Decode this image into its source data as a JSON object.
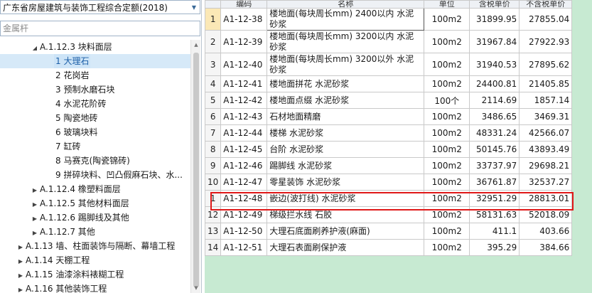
{
  "quota_selector": {
    "value": "广东省房屋建筑与装饰工程综合定额(2018)"
  },
  "search": {
    "placeholder": "金属杆",
    "value": ""
  },
  "tree": [
    {
      "label": "A.1.12.3 块料面层",
      "toggle": "◢",
      "level": 4
    },
    {
      "label": "1 大理石",
      "toggle": "",
      "level": 5,
      "selected": true
    },
    {
      "label": "2 花岗岩",
      "toggle": "",
      "level": 5
    },
    {
      "label": "3 预制水磨石块",
      "toggle": "",
      "level": 5
    },
    {
      "label": "4 水泥花阶砖",
      "toggle": "",
      "level": 5
    },
    {
      "label": "5 陶瓷地砖",
      "toggle": "",
      "level": 5
    },
    {
      "label": "6 玻璃块料",
      "toggle": "",
      "level": 5
    },
    {
      "label": "7 缸砖",
      "toggle": "",
      "level": 5
    },
    {
      "label": "8 马赛克(陶瓷锦砖)",
      "toggle": "",
      "level": 5
    },
    {
      "label": "9 拼碎块料、凹凸假麻石块、水...",
      "toggle": "",
      "level": 5
    },
    {
      "label": "A.1.12.4 橡塑料面层",
      "toggle": "▶",
      "level": 4
    },
    {
      "label": "A.1.12.5 其他材料面层",
      "toggle": "▶",
      "level": 4
    },
    {
      "label": "A.1.12.6 踢脚线及其他",
      "toggle": "▶",
      "level": 4
    },
    {
      "label": "A.1.12.7 其他",
      "toggle": "▶",
      "level": 4
    },
    {
      "label": "A.1.13 墙、柱面装饰与隔断、幕墙工程",
      "toggle": "▶",
      "level": 3
    },
    {
      "label": "A.1.14 天棚工程",
      "toggle": "▶",
      "level": 3
    },
    {
      "label": "A.1.15 油漆涂料裱糊工程",
      "toggle": "▶",
      "level": 3
    },
    {
      "label": "A.1.16 其他装饰工程",
      "toggle": "▶",
      "level": 3
    }
  ],
  "grid": {
    "columns": [
      "",
      "编码",
      "名称",
      "单位",
      "含税单价",
      "不含税单价"
    ],
    "rows": [
      {
        "n": "1",
        "code": "A1-12-38",
        "name": "楼地面(每块周长mm) 2400以内 水泥砂浆",
        "unit": "100m2",
        "p1": "31899.95",
        "p2": "27855.04"
      },
      {
        "n": "2",
        "code": "A1-12-39",
        "name": "楼地面(每块周长mm) 3200以内 水泥砂浆",
        "unit": "100m2",
        "p1": "31967.84",
        "p2": "27922.93"
      },
      {
        "n": "3",
        "code": "A1-12-40",
        "name": "楼地面(每块周长mm) 3200以外 水泥砂浆",
        "unit": "100m2",
        "p1": "31940.53",
        "p2": "27895.62"
      },
      {
        "n": "4",
        "code": "A1-12-41",
        "name": "楼地面拼花 水泥砂浆",
        "unit": "100m2",
        "p1": "24400.81",
        "p2": "21405.85"
      },
      {
        "n": "5",
        "code": "A1-12-42",
        "name": "楼地面点缀 水泥砂浆",
        "unit": "100个",
        "p1": "2114.69",
        "p2": "1857.14"
      },
      {
        "n": "6",
        "code": "A1-12-43",
        "name": "石材地面精磨",
        "unit": "100m2",
        "p1": "3486.65",
        "p2": "3469.31"
      },
      {
        "n": "7",
        "code": "A1-12-44",
        "name": "楼梯 水泥砂浆",
        "unit": "100m2",
        "p1": "48331.24",
        "p2": "42566.07"
      },
      {
        "n": "8",
        "code": "A1-12-45",
        "name": "台阶 水泥砂浆",
        "unit": "100m2",
        "p1": "50145.76",
        "p2": "43893.49"
      },
      {
        "n": "9",
        "code": "A1-12-46",
        "name": "踢脚线 水泥砂浆",
        "unit": "100m2",
        "p1": "33737.97",
        "p2": "29698.21"
      },
      {
        "n": "10",
        "code": "A1-12-47",
        "name": "零星装饰 水泥砂浆",
        "unit": "100m2",
        "p1": "36761.87",
        "p2": "32537.27"
      },
      {
        "n": "1",
        "code": "A1-12-48",
        "name": "嵌边(波打线) 水泥砂浆",
        "unit": "100m2",
        "p1": "32951.29",
        "p2": "28813.01"
      },
      {
        "n": "12",
        "code": "A1-12-49",
        "name": "梯级拦水线 石胶",
        "unit": "100m2",
        "p1": "58131.63",
        "p2": "52018.09"
      },
      {
        "n": "13",
        "code": "A1-12-50",
        "name": "大理石底面刷养护液(麻面)",
        "unit": "100m2",
        "p1": "411.1",
        "p2": "403.66"
      },
      {
        "n": "14",
        "code": "A1-12-51",
        "name": "大理石表面刷保护液",
        "unit": "100m2",
        "p1": "395.29",
        "p2": "384.66"
      }
    ]
  }
}
